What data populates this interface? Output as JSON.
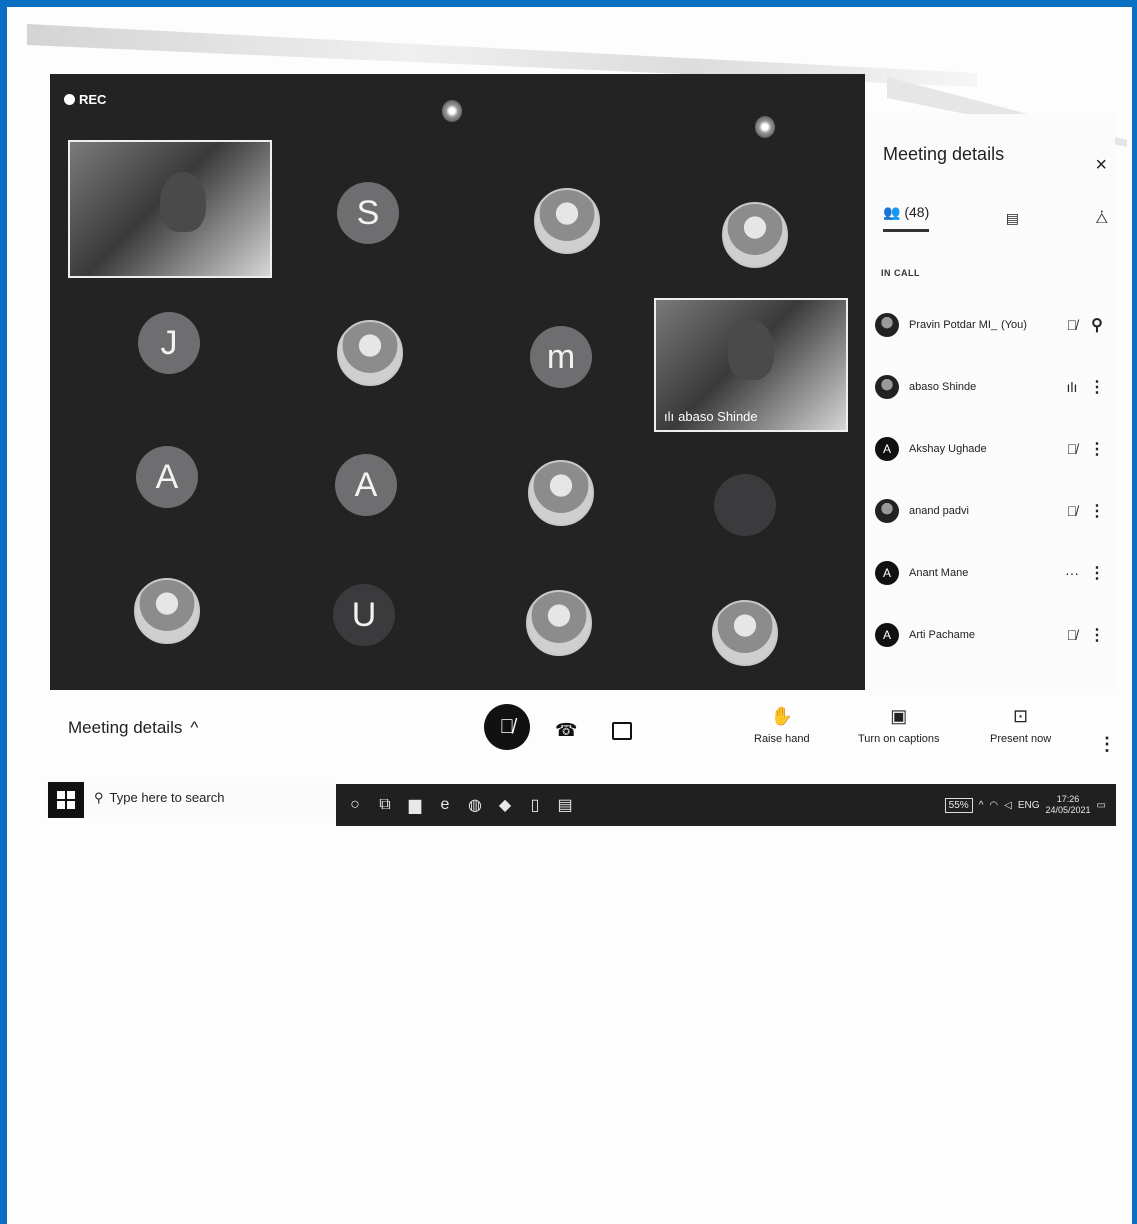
{
  "recording_label": "REC",
  "tiles": [
    {
      "kind": "video",
      "label": ""
    },
    {
      "kind": "letter",
      "label": "S"
    },
    {
      "kind": "photo",
      "label": ""
    },
    {
      "kind": "photo",
      "label": ""
    },
    {
      "kind": "letter",
      "label": "J"
    },
    {
      "kind": "photo",
      "label": ""
    },
    {
      "kind": "letter",
      "label": "m"
    },
    {
      "kind": "letter",
      "label": "A"
    },
    {
      "kind": "letter",
      "label": "A"
    },
    {
      "kind": "photo",
      "label": ""
    },
    {
      "kind": "photo",
      "label": ""
    },
    {
      "kind": "photo",
      "label": ""
    },
    {
      "kind": "dark",
      "label": "U"
    },
    {
      "kind": "photo",
      "label": ""
    },
    {
      "kind": "photo",
      "label": ""
    }
  ],
  "featured_video": {
    "name": "abaso Shinde"
  },
  "panel": {
    "title": "Meeting details",
    "close": "×",
    "people_count": "(48)",
    "section": "IN CALL",
    "participants": [
      {
        "name": "Pravin Potdar MI_",
        "you": "(You)",
        "avatar": "",
        "status": "🎙̸",
        "more": "⚲"
      },
      {
        "name": "abaso Shinde",
        "you": "",
        "avatar": "",
        "status": "ılı",
        "more": "⋮"
      },
      {
        "name": "Akshay Ughade",
        "you": "",
        "avatar": "A",
        "status": "🎙̸",
        "more": "⋮"
      },
      {
        "name": "anand padvi",
        "you": "",
        "avatar": "",
        "status": "🎙̸",
        "more": "⋮"
      },
      {
        "name": "Anant Mane",
        "you": "",
        "avatar": "A",
        "status": "···",
        "more": "⋮"
      },
      {
        "name": "Arti Pachame",
        "you": "",
        "avatar": "A",
        "status": "🎙̸",
        "more": "⋮"
      }
    ]
  },
  "controls": {
    "meeting_details": "Meeting details",
    "chevron": "^",
    "mic": "🎙̸",
    "hangup": "☎",
    "raise_hand": "Raise hand",
    "captions": "Turn on captions",
    "present": "Present now",
    "more": "⋮"
  },
  "taskbar": {
    "search_placeholder": "Type here to search",
    "battery": "55%",
    "lang": "ENG",
    "time": "17:26",
    "date": "24/05/2021"
  }
}
